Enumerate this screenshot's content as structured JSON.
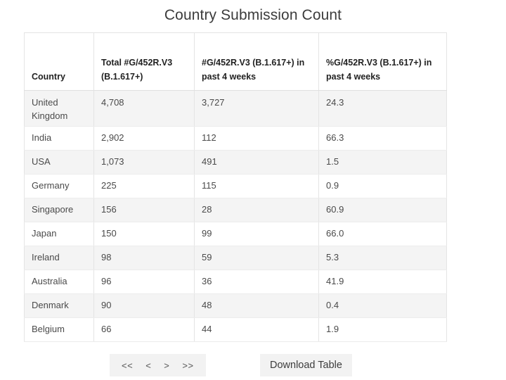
{
  "page": {
    "title": "Country Submission Count"
  },
  "table": {
    "columns": [
      "Country",
      "Total #G/452R.V3 (B.1.617+)",
      "#G/452R.V3 (B.1.617+) in past 4 weeks",
      "%G/452R.V3 (B.1.617+) in past 4 weeks"
    ],
    "rows": [
      {
        "country": "United Kingdom",
        "total": "4,708",
        "past4": "3,727",
        "pct": "24.3"
      },
      {
        "country": "India",
        "total": "2,902",
        "past4": "112",
        "pct": "66.3"
      },
      {
        "country": "USA",
        "total": "1,073",
        "past4": "491",
        "pct": "1.5"
      },
      {
        "country": "Germany",
        "total": "225",
        "past4": "115",
        "pct": "0.9"
      },
      {
        "country": "Singapore",
        "total": "156",
        "past4": "28",
        "pct": "60.9"
      },
      {
        "country": "Japan",
        "total": "150",
        "past4": "99",
        "pct": "66.0"
      },
      {
        "country": "Ireland",
        "total": "98",
        "past4": "59",
        "pct": "5.3"
      },
      {
        "country": "Australia",
        "total": "96",
        "past4": "36",
        "pct": "41.9"
      },
      {
        "country": "Denmark",
        "total": "90",
        "past4": "48",
        "pct": "0.4"
      },
      {
        "country": "Belgium",
        "total": "66",
        "past4": "44",
        "pct": "1.9"
      }
    ]
  },
  "footer": {
    "pagination": [
      {
        "name": "first-page",
        "label": "<<"
      },
      {
        "name": "prev-page",
        "label": "<"
      },
      {
        "name": "next-page",
        "label": ">"
      },
      {
        "name": "last-page",
        "label": ">>"
      }
    ],
    "download_label": "Download Table"
  },
  "colors": {
    "title_text": "#3c3c3c",
    "header_text": "#222222",
    "cell_text": "#4a4a4a",
    "row_stripe": "#f4f4f4",
    "border": "#e4e4e4",
    "control_bg": "#f2f2f2"
  }
}
